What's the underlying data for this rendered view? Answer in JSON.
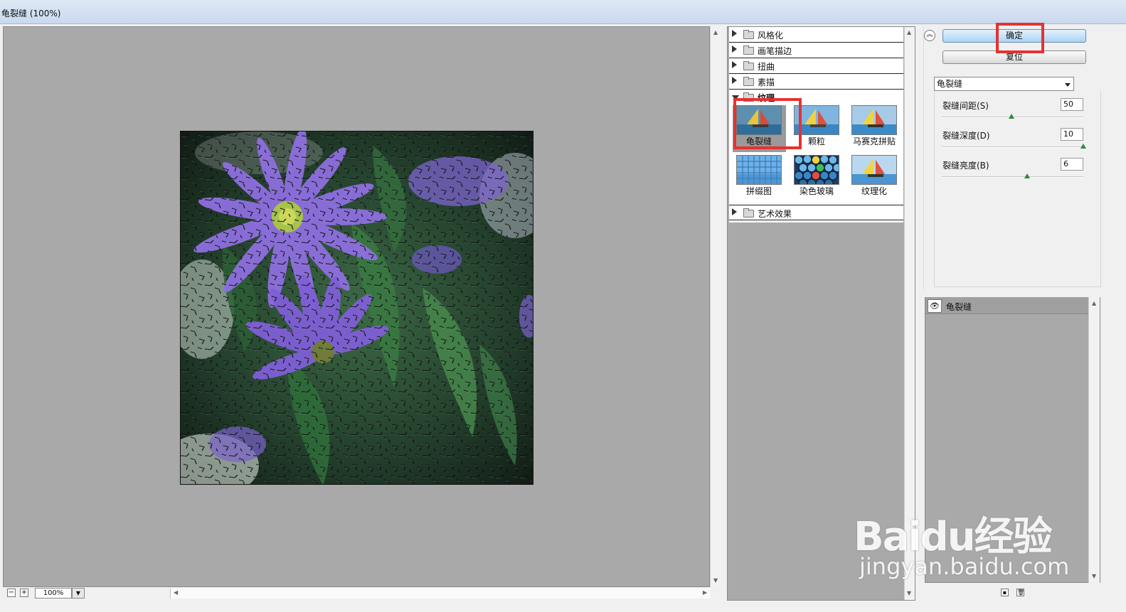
{
  "window": {
    "title": "龟裂缝 (100%)"
  },
  "preview": {
    "zoom": "100%"
  },
  "gallery": {
    "categories": [
      "风格化",
      "画笔描边",
      "扭曲",
      "素描",
      "纹理",
      "艺术效果"
    ],
    "texture_filters": [
      "龟裂缝",
      "颗粒",
      "马赛克拼贴",
      "拼缀图",
      "染色玻璃",
      "纹理化"
    ]
  },
  "buttons": {
    "ok": "确定",
    "reset": "复位"
  },
  "filter_select": {
    "value": "龟裂缝"
  },
  "params": [
    {
      "label": "裂缝间距(S)",
      "value": "50",
      "level": 0.49
    },
    {
      "label": "裂缝深度(D)",
      "value": "10",
      "level": 1.0
    },
    {
      "label": "裂缝亮度(B)",
      "value": "6",
      "level": 0.6
    }
  ],
  "layers": {
    "items": [
      "龟裂缝"
    ]
  },
  "watermark": {
    "logo": "Baidu经验",
    "url": "jingyan.baidu.com"
  },
  "colors": {
    "highlight": "#e53232",
    "canvas_bg": "#a9a9a9",
    "ok_button": "#a8d3f5"
  }
}
